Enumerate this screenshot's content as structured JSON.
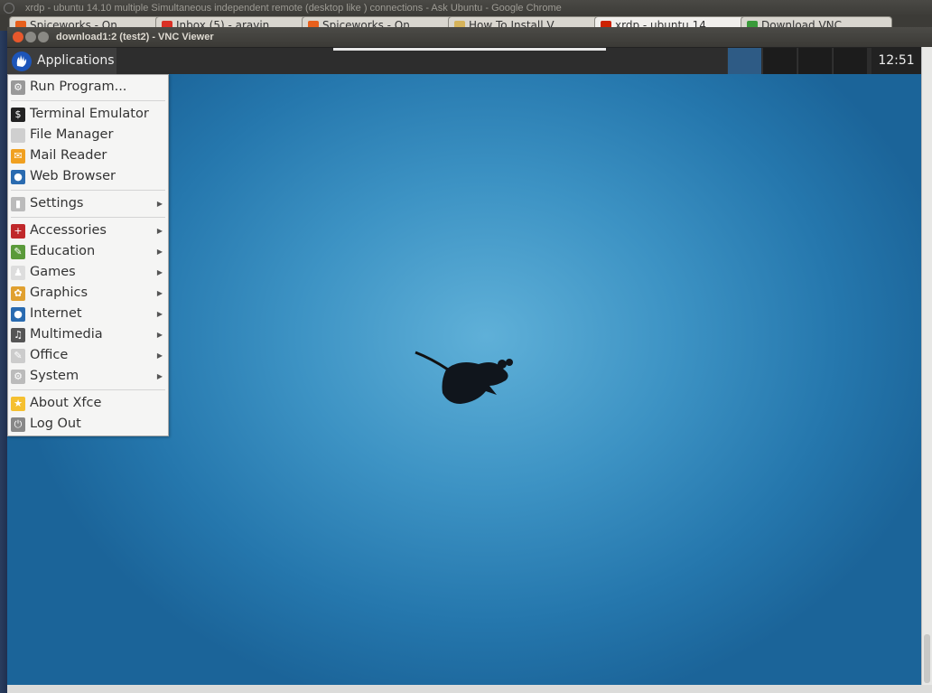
{
  "chrome": {
    "title": "xrdp - ubuntu 14.10 multiple Simultaneous independent remote (desktop like ) connections - Ask Ubuntu - Google Chrome",
    "tabs": [
      {
        "label": "Spiceworks - On",
        "color": "#e8601c"
      },
      {
        "label": "Inbox (5) - aravin",
        "color": "#d93025"
      },
      {
        "label": "Spiceworks - On",
        "color": "#e8601c"
      },
      {
        "label": "How To Install V",
        "color": "#d6b35a"
      },
      {
        "label": "xrdp - ubuntu 14",
        "color": "#cc2200",
        "active": true
      },
      {
        "label": "Download VNC",
        "color": "#3a9a3a"
      }
    ]
  },
  "vnc": {
    "title": "download1:2 (test2) - VNC Viewer"
  },
  "panel": {
    "applications_label": "Applications",
    "clock": "12:51",
    "active_workspace_color": "#2e5b85"
  },
  "menu": {
    "groups": [
      [
        {
          "label": "Run Program...",
          "icon": "gears-icon"
        }
      ],
      [
        {
          "label": "Terminal Emulator",
          "icon": "terminal-icon"
        },
        {
          "label": "File Manager",
          "icon": "folder-icon"
        },
        {
          "label": "Mail Reader",
          "icon": "mail-icon"
        },
        {
          "label": "Web Browser",
          "icon": "globe-icon"
        }
      ],
      [
        {
          "label": "Settings",
          "icon": "settings-icon",
          "submenu": true
        }
      ],
      [
        {
          "label": "Accessories",
          "icon": "accessories-icon",
          "submenu": true
        },
        {
          "label": "Education",
          "icon": "education-icon",
          "submenu": true
        },
        {
          "label": "Games",
          "icon": "games-icon",
          "submenu": true
        },
        {
          "label": "Graphics",
          "icon": "palette-icon",
          "submenu": true
        },
        {
          "label": "Internet",
          "icon": "globe-icon",
          "submenu": true
        },
        {
          "label": "Multimedia",
          "icon": "multimedia-icon",
          "submenu": true
        },
        {
          "label": "Office",
          "icon": "office-icon",
          "submenu": true
        },
        {
          "label": "System",
          "icon": "gear-icon",
          "submenu": true
        }
      ],
      [
        {
          "label": "About Xfce",
          "icon": "star-icon"
        },
        {
          "label": "Log Out",
          "icon": "power-icon"
        }
      ]
    ]
  }
}
